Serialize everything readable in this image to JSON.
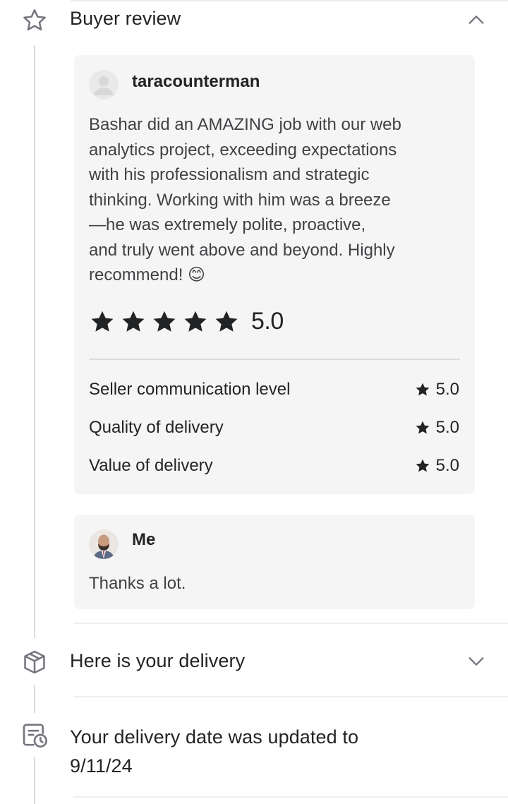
{
  "buyer_review": {
    "title": "Buyer review",
    "icon": "star-outline-icon",
    "expanded": true,
    "review": {
      "username": "taracounterman",
      "text": "Bashar did an AMAZING job with our web analytics project, exceeding expectations with his professionalism and strategic thinking. Working with him was a breeze—he was extremely polite, proactive, and truly went above and beyond. Highly recommend! 😊",
      "text_lines": [
        "Bashar did an AMAZING job with our web",
        "analytics project, exceeding expectations",
        "with his professionalism and strategic",
        "thinking. Working with him was a breeze",
        "—he was extremely polite, proactive,",
        "and truly went above and beyond. Highly",
        "recommend! 😊"
      ],
      "stars": 5,
      "rating": "5.0",
      "criteria": [
        {
          "label": "Seller communication level",
          "value": "5.0"
        },
        {
          "label": "Quality of delivery",
          "value": "5.0"
        },
        {
          "label": "Value of delivery",
          "value": "5.0"
        }
      ]
    },
    "reply": {
      "username": "Me",
      "text": "Thanks a lot."
    }
  },
  "delivery": {
    "title": "Here is your delivery",
    "icon": "package-box-icon",
    "expanded": false
  },
  "delivery_date": {
    "title_line1": "Your delivery date was updated to",
    "title_line2": "9/11/24",
    "icon": "calendar-clock-icon"
  },
  "colors": {
    "card_bg": "#f5f5f5",
    "text_primary": "#222325",
    "text_secondary": "#404145",
    "timeline": "#dadbdd",
    "icon_gray": "#74767e"
  }
}
